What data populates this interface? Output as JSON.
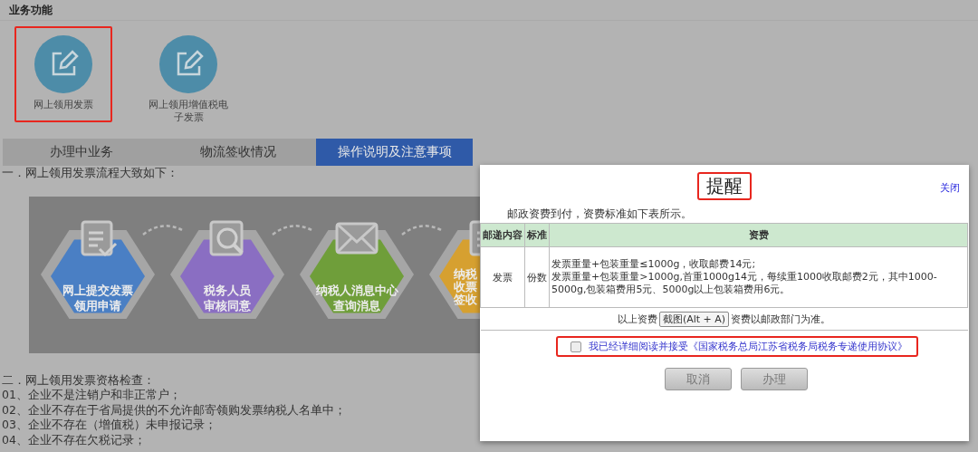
{
  "section_title": "业务功能",
  "functions": [
    {
      "label": "网上领用发票",
      "highlighted": true
    },
    {
      "label": "网上领用增值税电子发票",
      "highlighted": false
    }
  ],
  "tabs": [
    {
      "label": "办理中业务",
      "selected": false
    },
    {
      "label": "物流签收情况",
      "selected": false
    },
    {
      "label": "操作说明及注意事项",
      "selected": true
    }
  ],
  "flow_heading": "一．网上领用发票流程大致如下：",
  "flow_steps": [
    {
      "lines": [
        "网上提交发票",
        "领用申请"
      ],
      "color": "#4a7fc4",
      "kind": "document"
    },
    {
      "lines": [
        "税务人员",
        "审核同意"
      ],
      "color": "#8a6ec2",
      "kind": "search"
    },
    {
      "lines": [
        "纳税人消息中心",
        "查询消息"
      ],
      "color": "#6f9e3a",
      "kind": "mail"
    },
    {
      "lines": [
        "纳税",
        "收票",
        "签收"
      ],
      "color": "#d6a030",
      "kind": "document"
    }
  ],
  "check_heading": "二．网上领用发票资格检查：",
  "checks": [
    "01、企业不是注销户和非正常户；",
    "02、企业不存在于省局提供的不允许邮寄领购发票纳税人名单中；",
    "03、企业不存在（增值税）未申报记录；",
    "04、企业不存在欠税记录；"
  ],
  "dialog": {
    "title": "提醒",
    "title_highlighted": true,
    "close": "关闭",
    "intro": "邮政资费到付，资费标准如下表所示。",
    "table": {
      "columns": [
        "邮递内容",
        "标准",
        "资费"
      ],
      "rows": [
        [
          "发票",
          "份数",
          "发票重量+包装重量≤1000g，收取邮费14元;\n发票重量+包装重量>1000g,首重1000g14元，每续重1000收取邮费2元，其中1000-5000g,包装箱费用5元、5000g以上包装箱费用6元。"
        ]
      ]
    },
    "footnote_left": "以上资费",
    "footnote_right": "资费以邮政部门为准。",
    "tooltip": "截图(Alt + A)",
    "agreement": {
      "label": "我已经详细阅读并接受《国家税务总局江苏省税务局税务专递使用协议》",
      "checked": false,
      "highlighted": true
    },
    "buttons": [
      "取消",
      "办理"
    ]
  }
}
